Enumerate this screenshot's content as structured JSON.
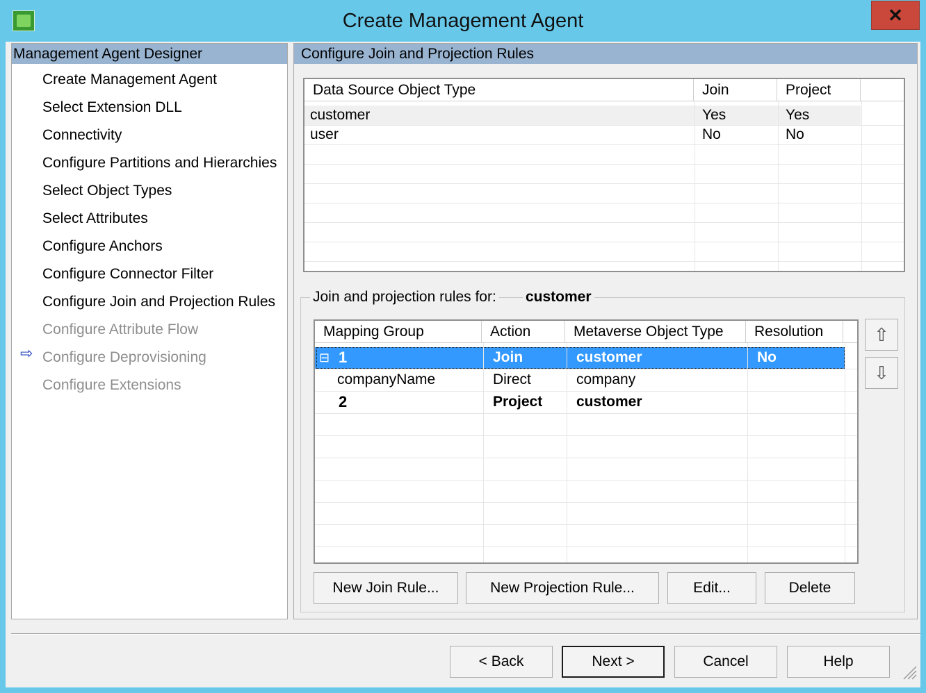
{
  "window": {
    "title": "Create Management Agent",
    "close_glyph": "✕"
  },
  "designer": {
    "header": "Management Agent Designer",
    "current_arrow": "⇨",
    "steps": [
      {
        "label": "Create Management Agent",
        "state": "enabled"
      },
      {
        "label": "Select Extension DLL",
        "state": "enabled"
      },
      {
        "label": "Connectivity",
        "state": "enabled"
      },
      {
        "label": "Configure Partitions and Hierarchies",
        "state": "enabled"
      },
      {
        "label": "Select Object Types",
        "state": "enabled"
      },
      {
        "label": "Select Attributes",
        "state": "enabled"
      },
      {
        "label": "Configure Anchors",
        "state": "enabled"
      },
      {
        "label": "Configure Connector Filter",
        "state": "enabled"
      },
      {
        "label": "Configure Join and Projection Rules",
        "state": "current"
      },
      {
        "label": "Configure Attribute Flow",
        "state": "disabled"
      },
      {
        "label": "Configure Deprovisioning",
        "state": "disabled"
      },
      {
        "label": "Configure Extensions",
        "state": "disabled"
      }
    ]
  },
  "page": {
    "header": "Configure Join and Projection Rules"
  },
  "object_types": {
    "columns": [
      "Data Source Object Type",
      "Join",
      "Project"
    ],
    "rows": [
      [
        "customer",
        "Yes",
        "Yes"
      ],
      [
        "user",
        "No",
        "No"
      ]
    ]
  },
  "rules": {
    "label": "Join and projection rules for:",
    "object": "customer",
    "columns": [
      "Mapping Group",
      "Action",
      "Metaverse Object Type",
      "Resolution"
    ],
    "rows": [
      {
        "group": "1",
        "action": "Join",
        "mv_type": "customer",
        "resolution": "No",
        "expander": "⊟"
      },
      {
        "group": "companyName",
        "action": "Direct",
        "mv_type": "company",
        "resolution": ""
      },
      {
        "group": "2",
        "action": "Project",
        "mv_type": "customer",
        "resolution": ""
      }
    ],
    "move_up_glyph": "⇧",
    "move_down_glyph": "⇩"
  },
  "buttons": {
    "new_join_rule": "New Join Rule...",
    "new_projection_rule": "New Projection Rule...",
    "edit": "Edit...",
    "delete": "Delete",
    "back": "<  Back",
    "next": "Next  >",
    "cancel": "Cancel",
    "help": "Help"
  },
  "colors": {
    "selection": "#3399ff",
    "titlebar": "#67c8ea",
    "panel_header": "#99b4d1",
    "close": "#c9483b"
  }
}
